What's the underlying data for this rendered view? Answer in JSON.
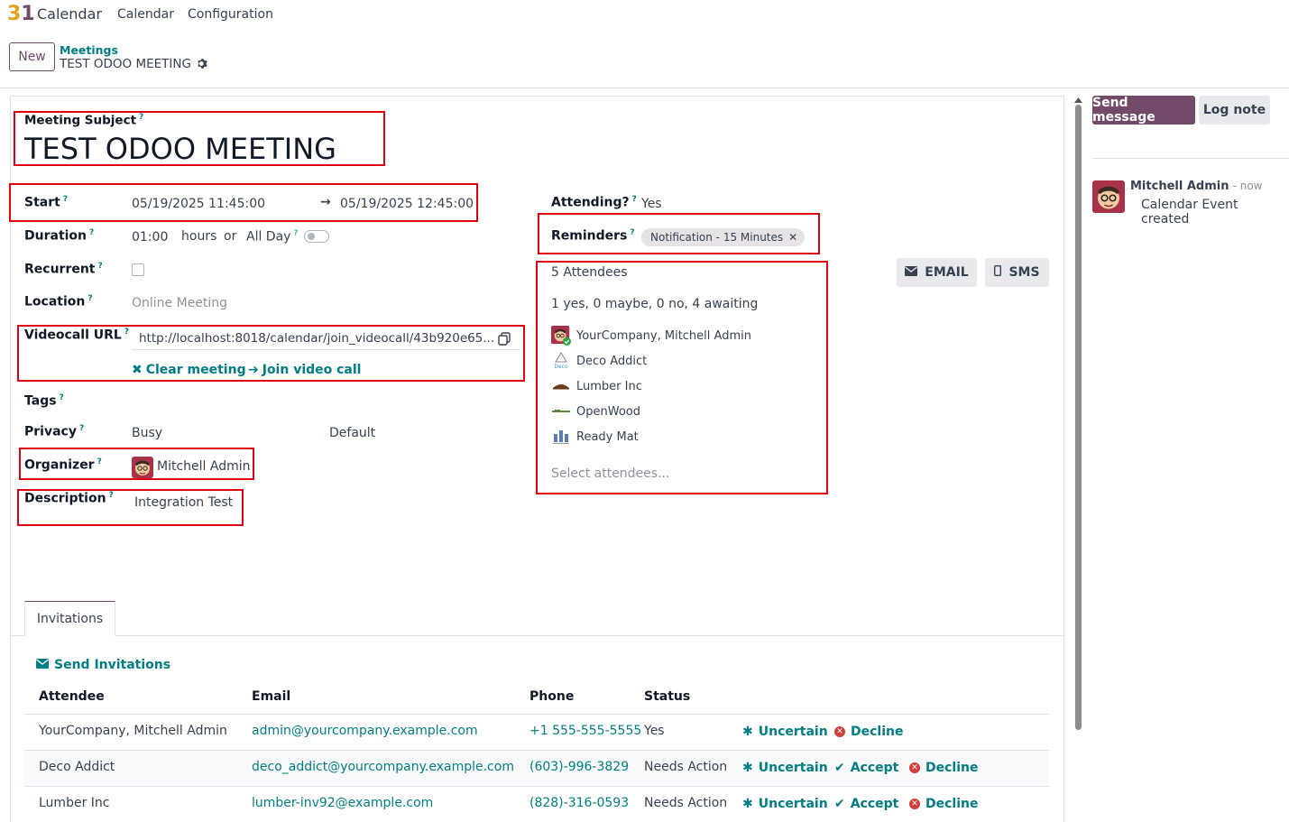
{
  "topnav": {
    "logo": "31",
    "app_name": "Calendar",
    "menu": [
      "Calendar",
      "Configuration"
    ]
  },
  "control_panel": {
    "new_label": "New",
    "breadcrumb_parent": "Meetings",
    "breadcrumb_current": "TEST ODOO MEETING"
  },
  "form": {
    "subject_label": "Meeting Subject",
    "subject_value": "TEST ODOO MEETING",
    "start_label": "Start",
    "start_value": "05/19/2025 11:45:00",
    "arrow": "→",
    "stop_value": "05/19/2025 12:45:00",
    "duration_label": "Duration",
    "duration_value": "01:00",
    "hours_label": "hours",
    "or_label": "or",
    "allday_label": "All Day",
    "recurrent_label": "Recurrent",
    "location_label": "Location",
    "location_placeholder": "Online Meeting",
    "videocall_label": "Videocall URL",
    "videocall_value": "http://localhost:8018/calendar/join_videocall/43b920e65...",
    "clear_meeting": "Clear meeting",
    "join_call": "Join video call",
    "tags_label": "Tags",
    "privacy_label": "Privacy",
    "privacy_value": "Busy",
    "privacy_default": "Default",
    "organizer_label": "Organizer",
    "organizer_value": "Mitchell Admin",
    "description_label": "Description",
    "description_value": "Integration Test",
    "attending_label": "Attending?",
    "attending_value": "Yes",
    "reminders_label": "Reminders",
    "reminder_chip": "Notification - 15 Minutes",
    "attendees_count": "5 Attendees",
    "attendees_summary": "1 yes, 0 maybe, 0 no, 4 awaiting",
    "attendees": [
      "YourCompany, Mitchell Admin",
      "Deco Addict",
      "Lumber Inc",
      "OpenWood",
      "Ready Mat"
    ],
    "select_attendees_placeholder": "Select attendees...",
    "email_btn": "EMAIL",
    "sms_btn": "SMS"
  },
  "tabs": {
    "invitations": "Invitations"
  },
  "invitations": {
    "send_label": "Send Invitations",
    "headers": [
      "Attendee",
      "Email",
      "Phone",
      "Status"
    ],
    "rows": [
      {
        "attendee": "YourCompany, Mitchell Admin",
        "email": "admin@yourcompany.example.com",
        "phone": "+1 555-555-5555",
        "status": "Yes"
      },
      {
        "attendee": "Deco Addict",
        "email": "deco_addict@yourcompany.example.com",
        "phone": "(603)-996-3829",
        "status": "Needs Action"
      },
      {
        "attendee": "Lumber Inc",
        "email": "lumber-inv92@example.com",
        "phone": "(828)-316-0593",
        "status": "Needs Action"
      }
    ],
    "uncertain": "Uncertain",
    "accept": "Accept",
    "decline": "Decline"
  },
  "chatter": {
    "send_message": "Send message",
    "log_note": "Log note",
    "author": "Mitchell Admin",
    "time": "- now",
    "body": "Calendar Event created"
  },
  "colors": {
    "brand": "#714b67",
    "link": "#017e84",
    "highlight": "#e0000f"
  }
}
